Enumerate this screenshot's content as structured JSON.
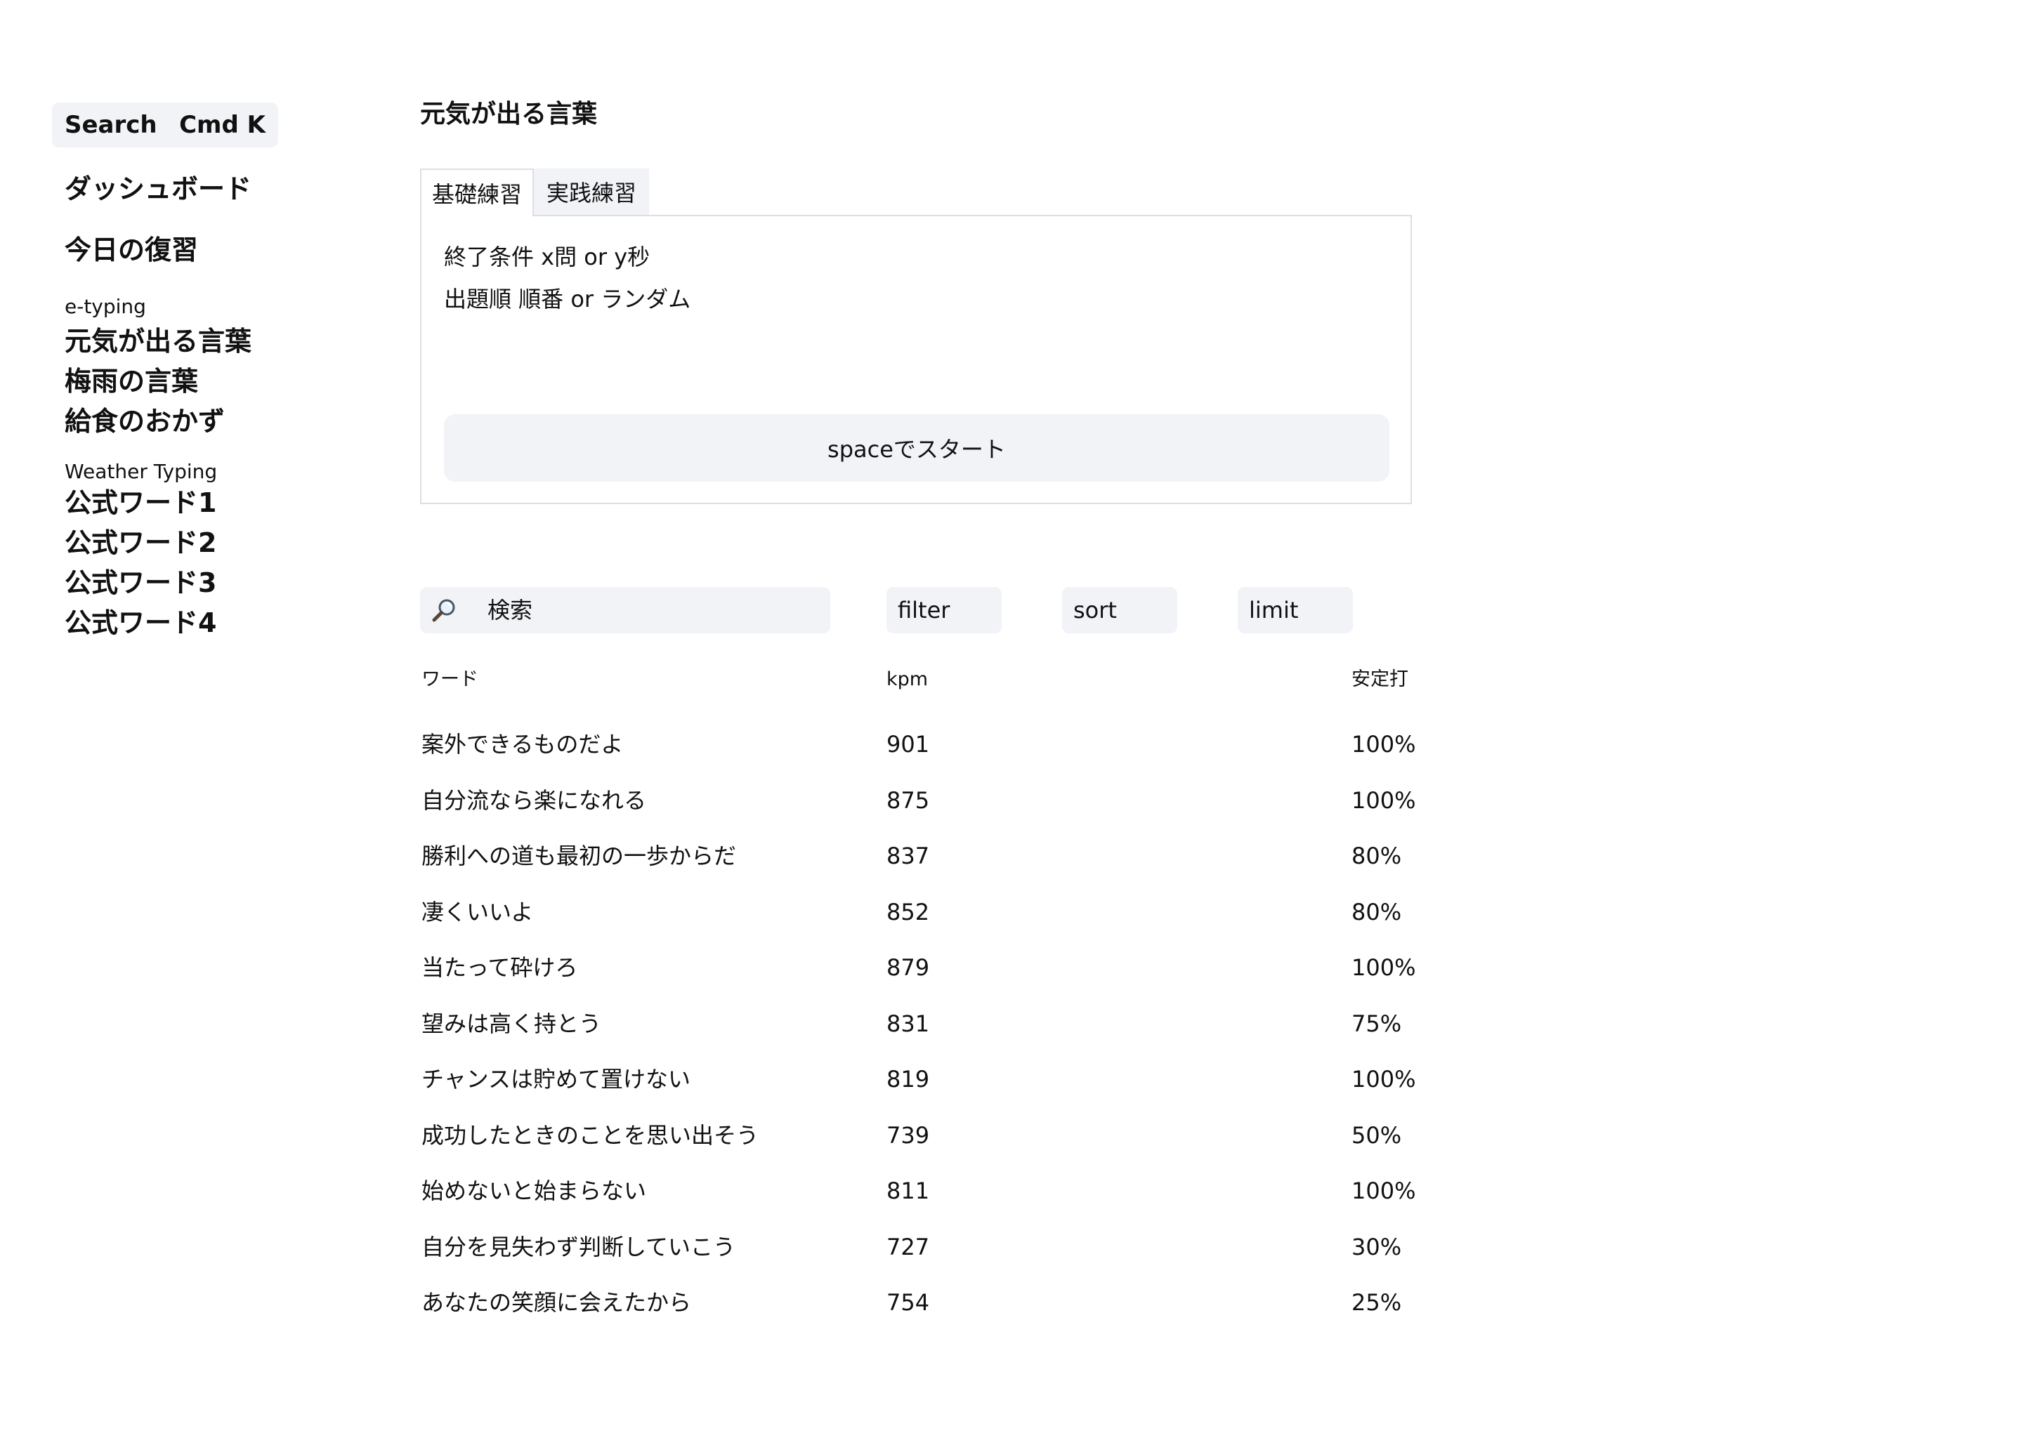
{
  "sidebar": {
    "search": {
      "label": "Search",
      "shortcut": "Cmd K"
    },
    "primary": [
      {
        "label": "ダッシュボード"
      },
      {
        "label": "今日の復習"
      }
    ],
    "groups": [
      {
        "label": "e-typing",
        "items": [
          "元気が出る言葉",
          "梅雨の言葉",
          "給食のおかず"
        ]
      },
      {
        "label": "Weather Typing",
        "items": [
          "公式ワード1",
          "公式ワード2",
          "公式ワード3",
          "公式ワード4"
        ]
      }
    ]
  },
  "main": {
    "title": "元気が出る言葉",
    "tabs": [
      {
        "label": "基礎練習",
        "active": true
      },
      {
        "label": "実践練習",
        "active": false
      }
    ],
    "panel": {
      "lines": [
        "終了条件 x問 or y秒",
        "出題順 順番 or ランダム"
      ],
      "start_label": "spaceでスタート"
    },
    "toolbar": {
      "search_icon": "magnifier-icon",
      "search_placeholder": "検索",
      "filter_label": "filter",
      "sort_label": "sort",
      "limit_label": "limit"
    },
    "table": {
      "columns": [
        "ワード",
        "kpm",
        "安定打"
      ],
      "rows": [
        {
          "word": "案外できるものだよ",
          "kpm": "901",
          "accuracy": "100%"
        },
        {
          "word": "自分流なら楽になれる",
          "kpm": "875",
          "accuracy": "100%"
        },
        {
          "word": "勝利への道も最初の一歩からだ",
          "kpm": "837",
          "accuracy": "80%"
        },
        {
          "word": "凄くいいよ",
          "kpm": "852",
          "accuracy": "80%"
        },
        {
          "word": "当たって砕けろ",
          "kpm": "879",
          "accuracy": "100%"
        },
        {
          "word": "望みは高く持とう",
          "kpm": "831",
          "accuracy": "75%"
        },
        {
          "word": "チャンスは貯めて置けない",
          "kpm": "819",
          "accuracy": "100%"
        },
        {
          "word": "成功したときのことを思い出そう",
          "kpm": "739",
          "accuracy": "50%"
        },
        {
          "word": "始めないと始まらない",
          "kpm": "811",
          "accuracy": "100%"
        },
        {
          "word": "自分を見失わず判断していこう",
          "kpm": "727",
          "accuracy": "30%"
        },
        {
          "word": "あなたの笑顔に会えたから",
          "kpm": "754",
          "accuracy": "25%"
        }
      ]
    }
  },
  "colors": {
    "surface": "#f1f3f7",
    "border": "#dcdfe6",
    "text": "#111111"
  }
}
